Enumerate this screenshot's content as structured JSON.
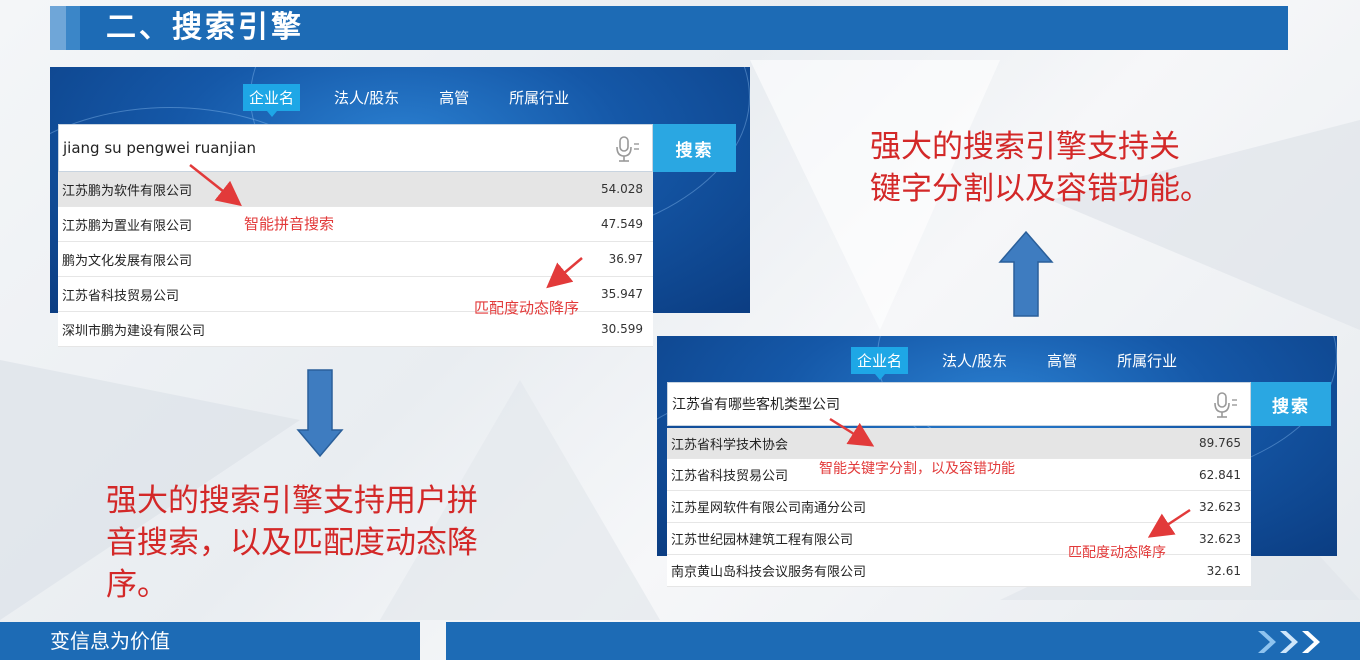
{
  "header": {
    "title": "二、搜索引擎"
  },
  "panel1": {
    "tabs": [
      "企业名",
      "法人/股东",
      "高管",
      "所属行业"
    ],
    "query": "jiang su pengwei ruanjian",
    "search_label": "搜索",
    "results": [
      {
        "name": "江苏鹏为软件有限公司",
        "score": "54.028"
      },
      {
        "name": "江苏鹏为置业有限公司",
        "score": "47.549"
      },
      {
        "name": "鹏为文化发展有限公司",
        "score": "36.97"
      },
      {
        "name": "江苏省科技贸易公司",
        "score": "35.947"
      },
      {
        "name": "深圳市鹏为建设有限公司",
        "score": "30.599"
      }
    ],
    "annotations": {
      "pinyin": "智能拼音搜索",
      "rank": "匹配度动态降序"
    }
  },
  "panel2": {
    "tabs": [
      "企业名",
      "法人/股东",
      "高管",
      "所属行业"
    ],
    "query": "江苏省有哪些客机类型公司",
    "search_label": "搜索",
    "results": [
      {
        "name": "江苏省科学技术协会",
        "score": "89.765"
      },
      {
        "name": "江苏省科技贸易公司",
        "score": "62.841"
      },
      {
        "name": "江苏星网软件有限公司南通分公司",
        "score": "32.623"
      },
      {
        "name": "江苏世纪园林建筑工程有限公司",
        "score": "32.623"
      },
      {
        "name": "南京黄山岛科技会议服务有限公司",
        "score": "32.61"
      }
    ],
    "annotations": {
      "keyword": "智能关键字分割，以及容错功能",
      "rank": "匹配度动态降序"
    }
  },
  "descriptions": {
    "right": [
      "强大的搜索引擎支持关",
      "键字分割以及容错功能。"
    ],
    "left": [
      "强大的搜索引擎支持用户拼",
      "音搜索，以及匹配度动态降",
      "序。"
    ]
  },
  "footer": {
    "slogan": "变信息为价值"
  },
  "colors": {
    "primary": "#1d6bb5",
    "accent": "#2aa7e2",
    "annotation": "#e23a3a",
    "description": "#d32828"
  }
}
